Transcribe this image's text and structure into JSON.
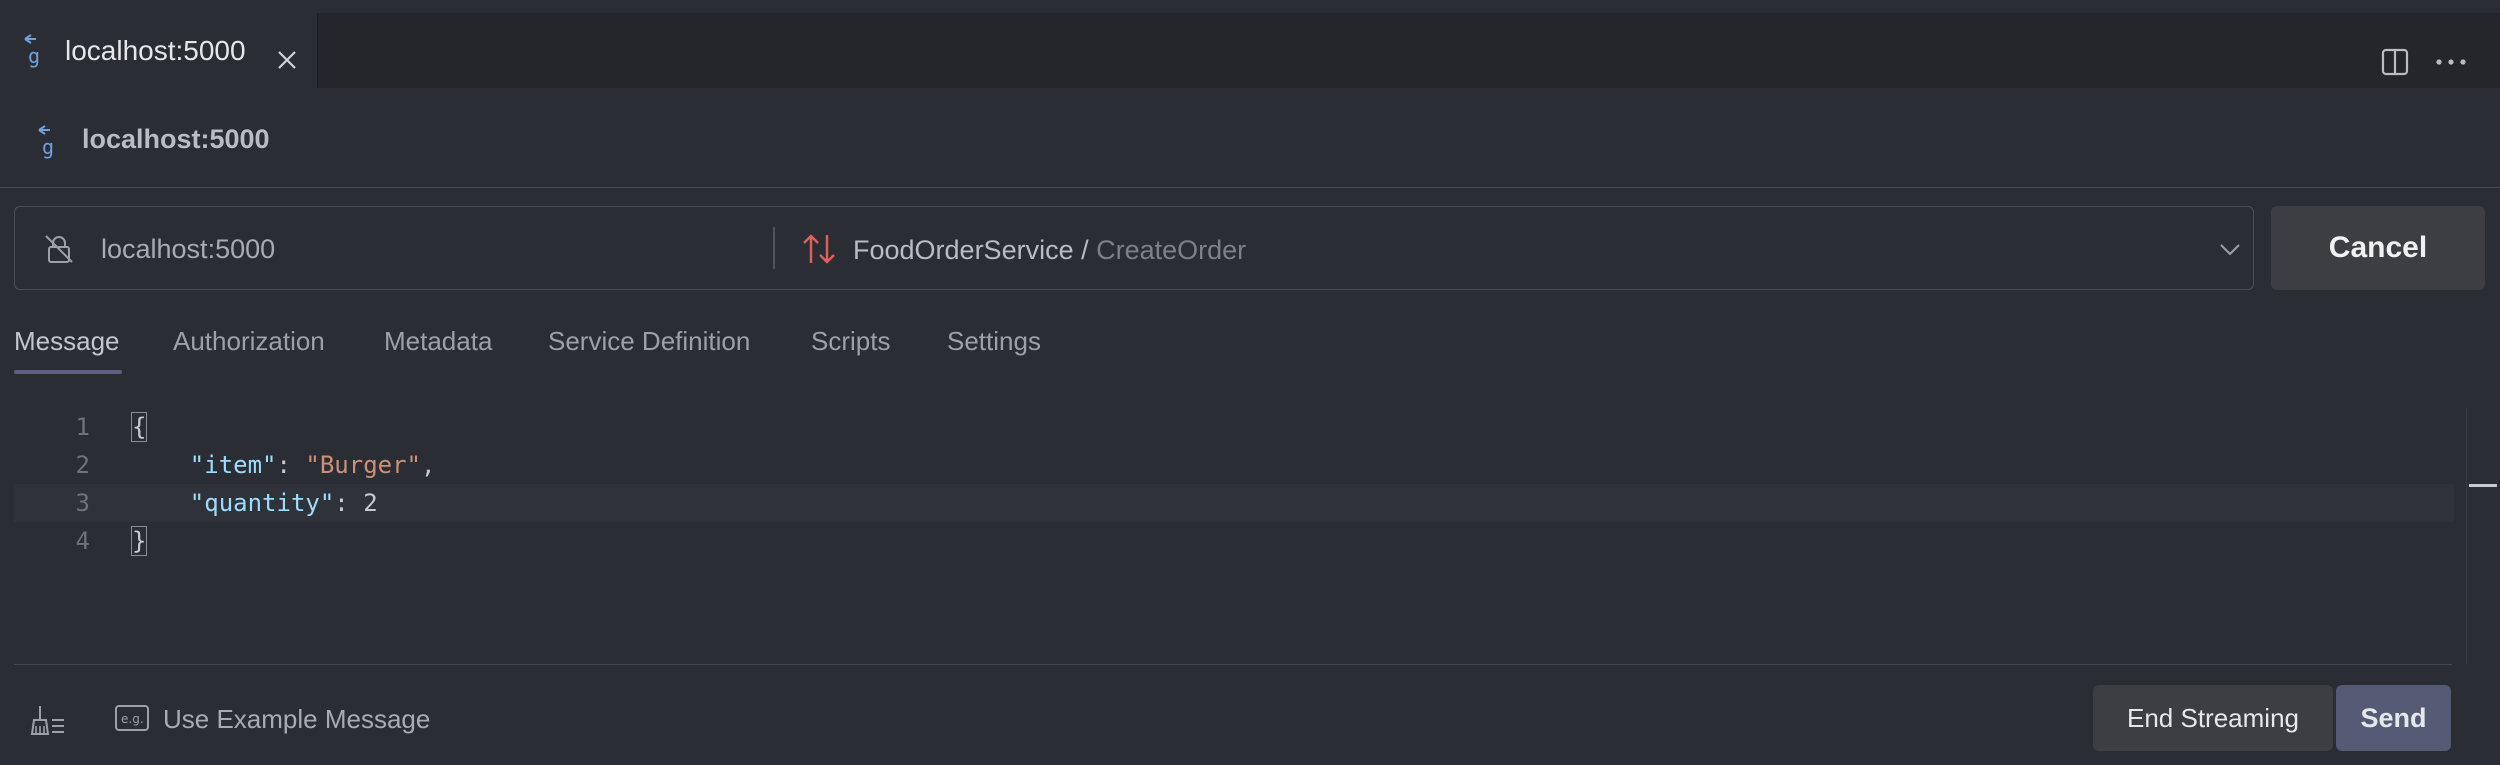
{
  "tab": {
    "title": "localhost:5000",
    "icon": "grpc-g-icon"
  },
  "header": {
    "title": "localhost:5000"
  },
  "address_bar": {
    "server": "localhost:5000",
    "service": "FoodOrderService",
    "separator": " / ",
    "method": "CreateOrder"
  },
  "actions": {
    "cancel_label": "Cancel",
    "end_streaming_label": "End Streaming",
    "send_label": "Send",
    "use_example_label": "Use Example Message"
  },
  "nav_tabs": [
    {
      "label": "Message",
      "active": true
    },
    {
      "label": "Authorization"
    },
    {
      "label": "Metadata"
    },
    {
      "label": "Service Definition"
    },
    {
      "label": "Scripts"
    },
    {
      "label": "Settings"
    }
  ],
  "editor": {
    "line_numbers": [
      "1",
      "2",
      "3",
      "4"
    ],
    "lines": {
      "l1": "{",
      "l2_indent": "    ",
      "l2_key": "\"item\"",
      "l2_colon": ": ",
      "l2_value": "\"Burger\"",
      "l2_comma": ",",
      "l3_indent": "    ",
      "l3_key": "\"quantity\"",
      "l3_colon": ": ",
      "l3_value": "2",
      "l4": "}"
    }
  },
  "colors": {
    "background": "#2b2d35",
    "tabstrip": "#24262c",
    "accent_underline": "#5d6080",
    "json_key": "#9cdcfe",
    "json_string": "#ce9178",
    "method_icon": "#e0605a",
    "send_button": "#555a75"
  }
}
